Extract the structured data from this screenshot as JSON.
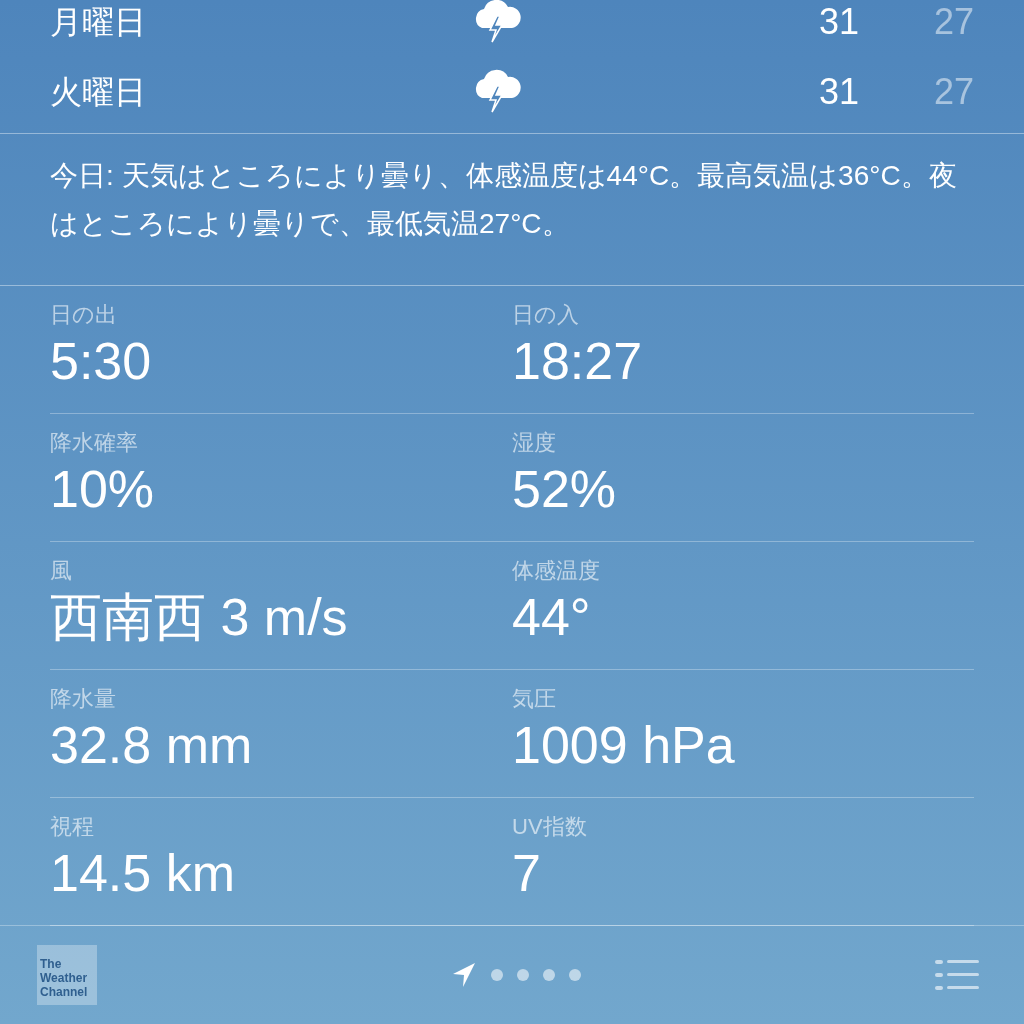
{
  "forecast": [
    {
      "day": "月曜日",
      "high": "31",
      "low": "27"
    },
    {
      "day": "火曜日",
      "high": "31",
      "low": "27"
    }
  ],
  "summary": "今日: 天気はところにより曇り、体感温度は44°C。最高気温は36°C。夜はところにより曇りで、最低気温27°C。",
  "details": [
    {
      "label": "日の出",
      "value": "5:30"
    },
    {
      "label": "日の入",
      "value": "18:27"
    },
    {
      "label": "降水確率",
      "value": "10%"
    },
    {
      "label": "湿度",
      "value": "52%"
    },
    {
      "label": "風",
      "value": "西南西 3 m/s"
    },
    {
      "label": "体感温度",
      "value": "44°"
    },
    {
      "label": "降水量",
      "value": "32.8 mm"
    },
    {
      "label": "気圧",
      "value": "1009 hPa"
    },
    {
      "label": "視程",
      "value": "14.5 km"
    },
    {
      "label": "UV指数",
      "value": "7"
    }
  ],
  "footer": {
    "logo": "The Weather Channel",
    "pages": [
      {
        "kind": "location",
        "selected": true
      },
      {
        "kind": "dot",
        "selected": false
      },
      {
        "kind": "dot",
        "selected": false
      },
      {
        "kind": "dot",
        "selected": false
      },
      {
        "kind": "dot",
        "selected": false
      }
    ]
  }
}
